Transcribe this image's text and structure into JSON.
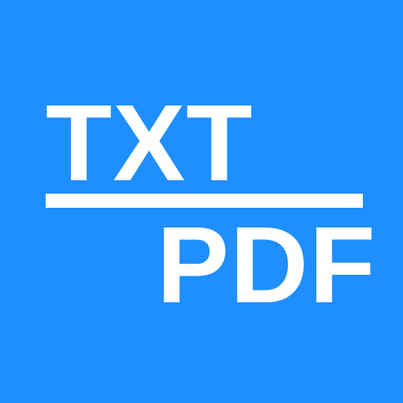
{
  "icon": {
    "background_color": "#1f8fff",
    "foreground_color": "#ffffff",
    "top_text": "TXT",
    "bottom_text": "PDF"
  }
}
